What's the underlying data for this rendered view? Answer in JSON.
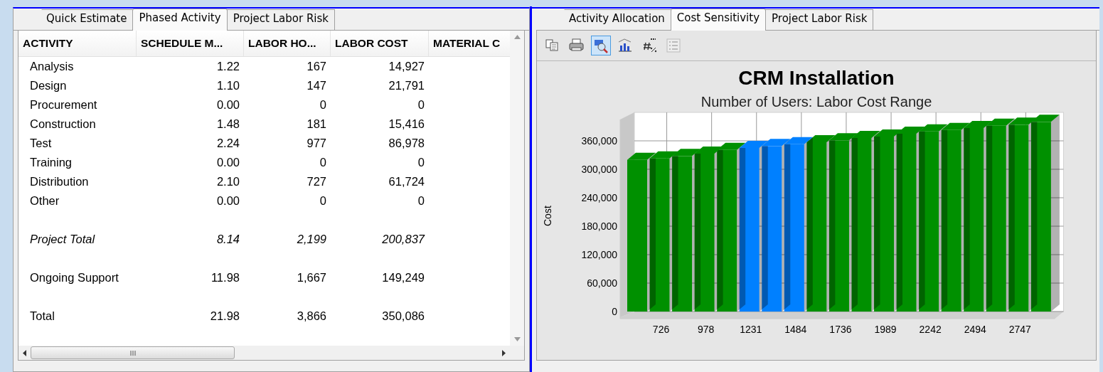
{
  "left_panel": {
    "tabs": [
      {
        "label": "Quick Estimate",
        "selected": false
      },
      {
        "label": "Phased Activity",
        "selected": true
      },
      {
        "label": "Project Labor Risk",
        "selected": false
      }
    ],
    "table": {
      "columns": [
        "ACTIVITY",
        "SCHEDULE M...",
        "LABOR HO...",
        "LABOR COST",
        "MATERIAL C"
      ],
      "rows": [
        {
          "kind": "item",
          "cells": [
            "Analysis",
            "1.22",
            "167",
            "14,927"
          ]
        },
        {
          "kind": "item",
          "cells": [
            "Design",
            "1.10",
            "147",
            "21,791"
          ]
        },
        {
          "kind": "item",
          "cells": [
            "Procurement",
            "0.00",
            "0",
            "0"
          ]
        },
        {
          "kind": "item",
          "cells": [
            "Construction",
            "1.48",
            "181",
            "15,416"
          ]
        },
        {
          "kind": "item",
          "cells": [
            "Test",
            "2.24",
            "977",
            "86,978"
          ]
        },
        {
          "kind": "item",
          "cells": [
            "Training",
            "0.00",
            "0",
            "0"
          ]
        },
        {
          "kind": "item",
          "cells": [
            "Distribution",
            "2.10",
            "727",
            "61,724"
          ]
        },
        {
          "kind": "item",
          "cells": [
            "Other",
            "0.00",
            "0",
            "0"
          ]
        },
        {
          "kind": "subtotal",
          "cells": [
            "Project Total",
            "8.14",
            "2,199",
            "200,837"
          ]
        },
        {
          "kind": "total",
          "cells": [
            "Ongoing Support",
            "11.98",
            "1,667",
            "149,249"
          ]
        },
        {
          "kind": "total",
          "cells": [
            "Total",
            "21.98",
            "3,866",
            "350,086"
          ]
        }
      ]
    }
  },
  "right_panel": {
    "tabs": [
      {
        "label": "Activity Allocation",
        "selected": false
      },
      {
        "label": "Cost Sensitivity",
        "selected": true
      },
      {
        "label": "Project Labor Risk",
        "selected": false
      }
    ],
    "toolbar": [
      {
        "kind": "copy",
        "selected": false,
        "disabled": false
      },
      {
        "kind": "print",
        "selected": false,
        "disabled": false
      },
      {
        "kind": "zoom",
        "selected": true,
        "disabled": false
      },
      {
        "kind": "chart",
        "selected": false,
        "disabled": false
      },
      {
        "kind": "format",
        "selected": false,
        "disabled": false
      },
      {
        "kind": "legend",
        "selected": false,
        "disabled": true
      }
    ],
    "subtitle": "Number of Users: Labor Cost Range",
    "chart_data": {
      "type": "bar",
      "title": "CRM Installation",
      "ylabel": "Cost",
      "categories": [
        null,
        "726",
        null,
        "978",
        null,
        "1231",
        null,
        "1484",
        null,
        "1736",
        null,
        "1989",
        null,
        "2242",
        null,
        "2494",
        null,
        "2747",
        null
      ],
      "yticks": [
        {
          "value": 0,
          "label": "0"
        },
        {
          "value": 60000,
          "label": "60,000"
        },
        {
          "value": 120000,
          "label": "120,000"
        },
        {
          "value": 180000,
          "label": "180,000"
        },
        {
          "value": 240000,
          "label": "240,000"
        },
        {
          "value": 300000,
          "label": "300,000"
        },
        {
          "value": 360000,
          "label": "360,000"
        }
      ],
      "ylim": [
        0,
        420000
      ],
      "grid": true,
      "series": [
        {
          "color": "#009000",
          "values": [
            320000,
            323000,
            328000,
            333000,
            341000,
            null,
            null,
            null,
            357000,
            361000,
            366000,
            369000,
            375000,
            380000,
            383000,
            387000,
            392000,
            394000,
            400000
          ]
        },
        {
          "color": "#0080ff",
          "values": [
            null,
            null,
            null,
            null,
            null,
            345000,
            349000,
            353000,
            null,
            null,
            null,
            null,
            null,
            null,
            null,
            null,
            null,
            null,
            null
          ]
        }
      ]
    }
  }
}
